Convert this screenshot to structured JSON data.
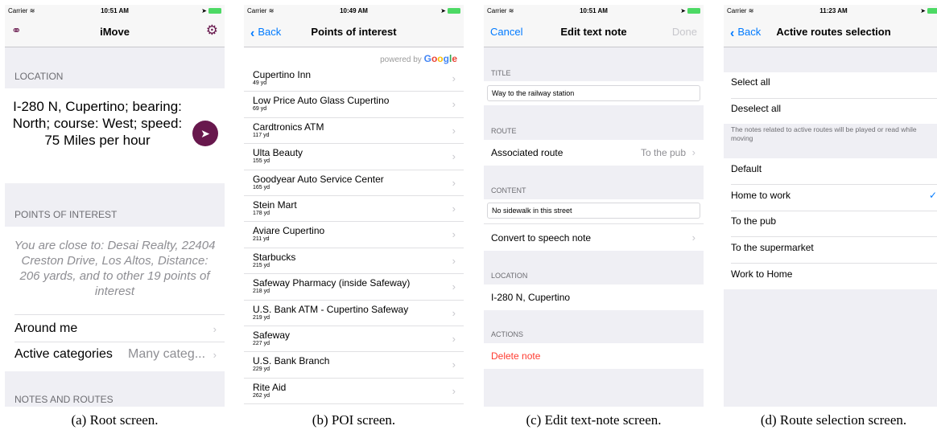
{
  "status": {
    "carrier": "Carrier",
    "wifi_icon": "wifi-icon",
    "battery_color": "#4cd964"
  },
  "root": {
    "time": "10:51 AM",
    "title": "iMove",
    "location_header": "LOCATION",
    "location_text": "I-280 N, Cupertino; bearing: North; course: West; speed: 75 Miles per hour",
    "poi_header": "POINTS OF INTEREST",
    "poi_text": "You are close to: Desai Realty, 22404 Creston Drive, Los Altos, Distance: 206 yards, and to other 19 points of interest",
    "around_me": "Around me",
    "active_categories_label": "Active categories",
    "active_categories_value": "Many categ...",
    "notes_header": "NOTES AND ROUTES",
    "accent": "#68184d"
  },
  "poi": {
    "time": "10:49 AM",
    "back": "Back",
    "title": "Points of interest",
    "powered_by": "powered by",
    "google": [
      "G",
      "o",
      "o",
      "g",
      "l",
      "e"
    ],
    "items": [
      {
        "name": "Cupertino Inn",
        "dist": "49 yd"
      },
      {
        "name": "Low Price Auto Glass Cupertino",
        "dist": "69 yd"
      },
      {
        "name": "Cardtronics ATM",
        "dist": "117 yd"
      },
      {
        "name": "Ulta Beauty",
        "dist": "155 yd"
      },
      {
        "name": "Goodyear Auto Service Center",
        "dist": "165 yd"
      },
      {
        "name": "Stein Mart",
        "dist": "178 yd"
      },
      {
        "name": "Aviare Cupertino",
        "dist": "211 yd"
      },
      {
        "name": "Starbucks",
        "dist": "215 yd"
      },
      {
        "name": "Safeway Pharmacy (inside Safeway)",
        "dist": "218 yd"
      },
      {
        "name": "U.S. Bank ATM - Cupertino Safeway",
        "dist": "219 yd"
      },
      {
        "name": "Safeway",
        "dist": "227 yd"
      },
      {
        "name": "U.S. Bank Branch",
        "dist": "229 yd"
      },
      {
        "name": "Rite Aid",
        "dist": "262 yd"
      }
    ]
  },
  "edit": {
    "time": "10:51 AM",
    "cancel": "Cancel",
    "title": "Edit text note",
    "done": "Done",
    "title_header": "TITLE",
    "title_value": "Way to the railway station",
    "route_header": "ROUTE",
    "associated_route_label": "Associated route",
    "associated_route_value": "To the pub",
    "content_header": "CONTENT",
    "content_value": "No sidewalk in this street",
    "convert": "Convert to speech note",
    "location_header": "LOCATION",
    "location_value": "I-280 N, Cupertino",
    "actions_header": "ACTIONS",
    "delete": "Delete note",
    "delete_color": "#ff3b30"
  },
  "routes": {
    "time": "11:23 AM",
    "back": "Back",
    "title": "Active routes selection",
    "select_all": "Select all",
    "deselect_all": "Deselect all",
    "note": "The notes related to active routes will be played or read while moving",
    "items": [
      {
        "name": "Default",
        "checked": false
      },
      {
        "name": "Home to work",
        "checked": true
      },
      {
        "name": "To the pub",
        "checked": false
      },
      {
        "name": "To the supermarket",
        "checked": false
      },
      {
        "name": "Work to Home",
        "checked": false
      }
    ]
  },
  "captions": [
    "(a)  Root screen.",
    "(b)  POI screen.",
    "(c)  Edit text-note screen.",
    "(d)  Route selection screen."
  ]
}
